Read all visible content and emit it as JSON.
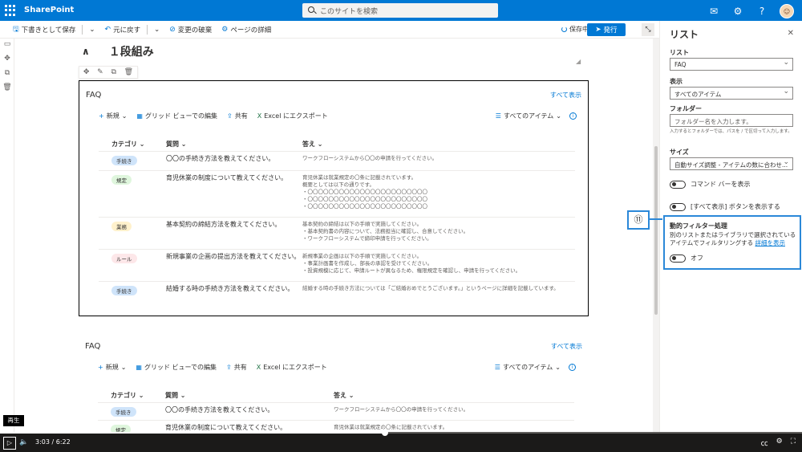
{
  "suitebar": {
    "brand": "SharePoint",
    "search_placeholder": "このサイトを検索"
  },
  "cmdbar": {
    "save_draft": "下書きとして保存",
    "undo": "元に戻す",
    "discard": "変更の破棄",
    "page_details": "ページの詳細",
    "saving": "保存中",
    "publish": "発行"
  },
  "section": {
    "title": "１段組み"
  },
  "webpart1": {
    "title": "FAQ",
    "see_all": "すべて表示",
    "cmd_new": "新規",
    "cmd_grid": "グリッド ビューでの編集",
    "cmd_share": "共有",
    "cmd_excel": "Excel にエクスポート",
    "view": "すべてのアイテム",
    "columns": [
      "カテゴリ",
      "質問",
      "答え"
    ],
    "rows": [
      {
        "category": "手続き",
        "question": "〇〇の手続き方法を教えてください。",
        "answer": "ワークフローシステムから〇〇の申請を行ってください。"
      },
      {
        "category": "規定",
        "question": "育児休業の制度について教えてください。",
        "answer": "育児休業は就業規定の〇条に記載されています。\n概要としては以下の通りです。\n・〇〇〇〇〇〇〇〇〇〇〇〇〇〇〇〇〇〇〇〇〇〇〇\n・〇〇〇〇〇〇〇〇〇〇〇〇〇〇〇〇〇〇〇〇〇〇〇\n・〇〇〇〇〇〇〇〇〇〇〇〇〇〇〇〇〇〇〇〇〇〇〇"
      },
      {
        "category": "業務",
        "question": "基本契約の締結方法を教えてください。",
        "answer": "基本契約の締結は以下の手順で実施してください。\n・基本契約書の内容について、法務担当に確認し、合意してください。\n・ワークフローシステムで締印申請を行ってください。"
      },
      {
        "category": "ルール",
        "question": "新規事業の企画の提出方法を教えてください。",
        "answer": "新規事業の企画は以下の手順で実施してください。\n・事業計画書を作成し、部長の承認を受けてください。\n・投資規模に応じて、申請ルートが異なるため、権限規定を確認し、申請を行ってください。"
      },
      {
        "category": "手続き",
        "question": "結婚する時の手続き方法を教えてください。",
        "answer": "結婚する時の手続き方法については「ご結婚おめでとうございます。」というページに詳細を記載しています。"
      }
    ]
  },
  "webpart2": {
    "title": "FAQ",
    "see_all": "すべて表示",
    "cmd_new": "新規",
    "cmd_grid": "グリッド ビューでの編集",
    "cmd_share": "共有",
    "cmd_excel": "Excel にエクスポート",
    "view": "すべてのアイテム",
    "columns": [
      "カテゴリ",
      "質問",
      "答え"
    ],
    "rows": [
      {
        "category": "手続き",
        "question": "〇〇の手続き方法を教えてください。",
        "answer": "ワークフローシステムから〇〇の申請を行ってください。"
      },
      {
        "category": "規定",
        "question": "育児休業の制度について教えてください。",
        "answer": "育児休業は就業規定の〇条に記載されています。"
      }
    ]
  },
  "panel": {
    "title": "リスト",
    "list_label": "リスト",
    "list_value": "FAQ",
    "view_label": "表示",
    "view_value": "すべてのアイテム",
    "folder_label": "フォルダー",
    "folder_placeholder": "フォルダー名を入力します。",
    "folder_hint": "入力するとフォルダーでは、パスを / で区切って入力します。",
    "size_label": "サイズ",
    "size_value": "自動サイズ調整 - アイテムの数に合わせ...",
    "toggle_cmdbar": "コマンド バーを表示",
    "toggle_seeall": "[すべて表示] ボタンを表示する",
    "dynamic_title": "動的フィルター処理",
    "dynamic_text": "別のリストまたはライブラリで選択されているアイテムでフィルタリングする",
    "dynamic_link": "詳細を表示",
    "dynamic_toggle": "オフ"
  },
  "annotation": {
    "badge": "⑪"
  },
  "player": {
    "tooltip": "再生",
    "time": "3:03 / 6:22",
    "progress": 0.48
  },
  "colors": {
    "accent": "#0078d4",
    "pill_procedure": "#cfe4fa",
    "pill_rule": "#dff6dd",
    "pill_business": "#fff1cc",
    "pill_policy": "#fde7e9"
  }
}
